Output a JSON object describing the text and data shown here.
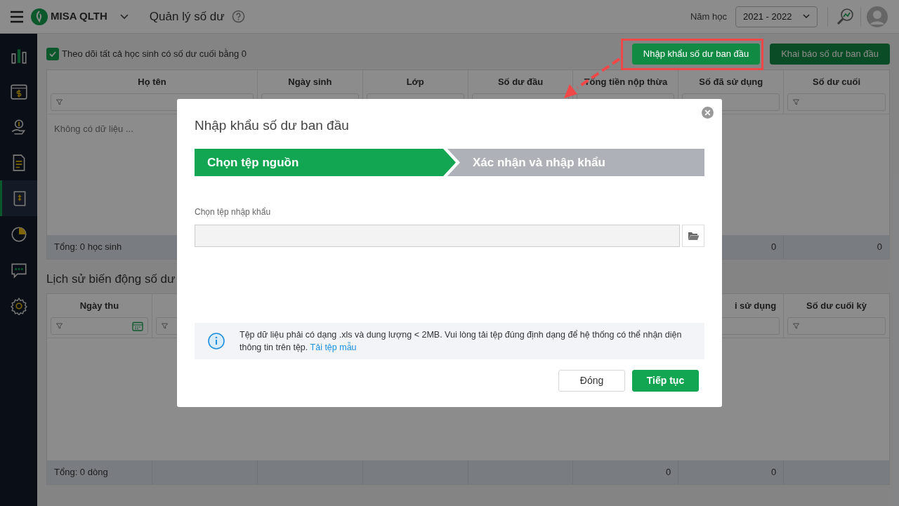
{
  "top_bar": {
    "app_name": "MISA QLTH",
    "page_title": "Quản lý số dư",
    "year_label": "Năm học",
    "year_value": "2021 - 2022"
  },
  "sidebar": {
    "items": [
      {
        "selected": false
      },
      {
        "selected": false
      },
      {
        "selected": false
      },
      {
        "selected": false
      },
      {
        "selected": true
      },
      {
        "selected": false
      },
      {
        "selected": false
      },
      {
        "selected": false
      }
    ]
  },
  "toolbar": {
    "checkbox": {
      "label": "Theo dõi tất cả học sinh có số dư cuối bằng 0",
      "checked": true
    },
    "buttons": [
      {
        "label": "Nhập khẩu số dư ban đầu",
        "highlighted": true
      },
      {
        "label": "Khai báo số dư ban đầu",
        "highlighted": false
      }
    ]
  },
  "balances_table": {
    "columns": [
      {
        "header": "Họ tên",
        "footer": "Tổng: 0 học sinh"
      },
      {
        "header": "Ngày sinh"
      },
      {
        "header": "Lớp"
      },
      {
        "header": "Số dư đầu"
      },
      {
        "header": "Tổng tiền nộp thừa"
      },
      {
        "header": "Số đã sử dụng",
        "footer": "0"
      },
      {
        "header": "Số dư cuối",
        "footer": "0"
      }
    ],
    "empty_message": "Không có dữ liệu ..."
  },
  "history": {
    "title": "Lịch sử biến động số dư",
    "columns": [
      {
        "header": "Ngày thu",
        "footer": "Tổng: 0 dòng"
      },
      {},
      {},
      {},
      {},
      {
        "footer": "0"
      },
      {
        "header": "i sử dụng",
        "footer": "0"
      },
      {
        "header": "Số dư cuối kỳ"
      }
    ]
  },
  "dialog": {
    "title": "Nhập khẩu số dư ban đầu",
    "steps": [
      {
        "label": "Chọn tệp nguồn",
        "current": true
      },
      {
        "label": "Xác nhận và nhập khẩu",
        "current": false
      }
    ],
    "file_label": "Chọn tệp nhập khẩu",
    "note": "Tệp dữ liệu phải có dạng .xls và dung lượng < 2MB. Vui lòng tải tệp đúng định dạng để hệ thống có thể nhận diện thông tin trên tệp.",
    "note_link": "Tải tệp mẫu",
    "buttons": [
      {
        "label": "Đóng",
        "kind": "secondary"
      },
      {
        "label": "Tiếp tục",
        "kind": "primary"
      }
    ]
  }
}
